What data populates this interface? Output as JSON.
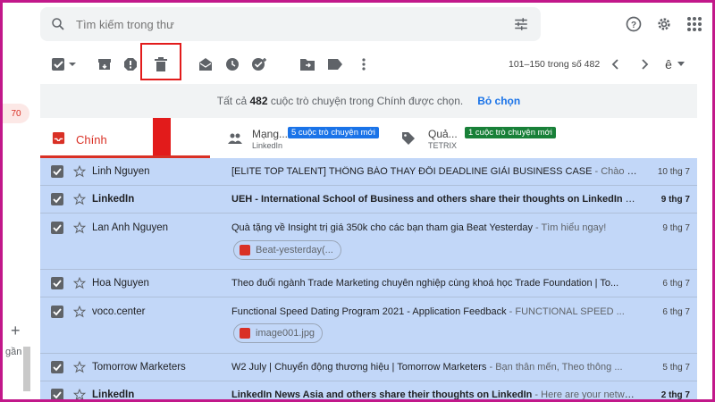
{
  "search": {
    "placeholder": "Tìm kiếm trong thư"
  },
  "left": {
    "badge": "70",
    "label": "gần"
  },
  "pagination": {
    "range": "101–150 trong số 482"
  },
  "notice": {
    "prefix": "Tất cả",
    "count": "482",
    "suffix": "cuộc trò chuyện trong Chính được chọn.",
    "action": "Bỏ chọn"
  },
  "tabs": {
    "main": "Chính",
    "social": {
      "name": "Mạng...",
      "badge": "5 cuộc trò chuyện mới",
      "sub": "LinkedIn",
      "badge_color": "#1a73e8"
    },
    "promo": {
      "name": "Quả...",
      "badge": "1 cuộc trò chuyện mới",
      "sub": "TETRIX",
      "badge_color": "#188038"
    }
  },
  "emails": [
    {
      "sender": "Linh Nguyen",
      "subject": "[ELITE TOP TALENT] THÔNG BÁO THAY ĐỔI DEADLINE GIẢI BUSINESS CASE",
      "snippet": " - Chào cá...",
      "date": "10 thg 7",
      "unread": false
    },
    {
      "sender": "LinkedIn",
      "subject": "UEH - International School of Business and others share their thoughts on LinkedIn",
      "snippet": " - H...",
      "date": "9 thg 7",
      "unread": true
    },
    {
      "sender": "Lan Anh Nguyen",
      "subject": "Quà tặng về Insight trị giá 350k cho các bạn tham gia Beat Yesterday",
      "snippet": " - Tìm hiểu ngay!",
      "date": "9 thg 7",
      "unread": false,
      "attachment": "Beat-yesterday(..."
    },
    {
      "sender": "Hoa Nguyen",
      "subject": "Theo đuổi ngành Trade Marketing chuyên nghiệp cùng khoá học Trade Foundation | To...",
      "snippet": "",
      "date": "6 thg 7",
      "unread": false
    },
    {
      "sender": "voco.center",
      "subject": "Functional Speed Dating Program 2021 - Application Feedback",
      "snippet": " - FUNCTIONAL SPEED ...",
      "date": "6 thg 7",
      "unread": false,
      "attachment": "image001.jpg"
    },
    {
      "sender": "Tomorrow Marketers",
      "subject": "W2 July | Chuyển động thương hiệu | Tomorrow Marketers",
      "snippet": " - Bạn thân mến, Theo thông ...",
      "date": "5 thg 7",
      "unread": false
    },
    {
      "sender": "LinkedIn",
      "subject": "LinkedIn News Asia and others share their thoughts on LinkedIn",
      "snippet": " - Here are your netwo...",
      "date": "2 thg 7",
      "unread": true
    }
  ],
  "colors": {
    "selected_row": "#c2d7f8",
    "accent": "#d93025",
    "highlight": "#e21b1b",
    "frame": "#c2188a"
  }
}
